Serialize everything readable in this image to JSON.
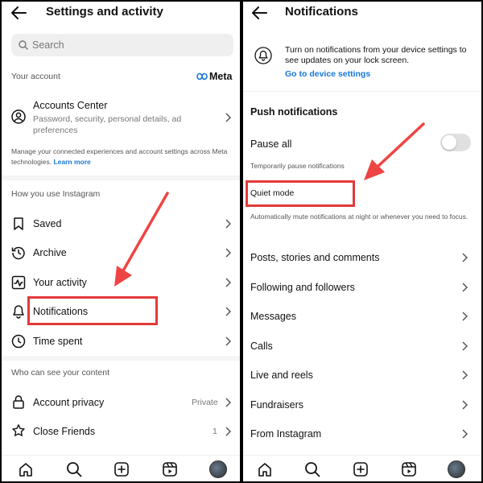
{
  "left": {
    "header": {
      "title": "Settings and activity"
    },
    "search": {
      "placeholder": "Search"
    },
    "your_account": {
      "section_label": "Your account",
      "meta_logo_text": "Meta",
      "accounts_center": {
        "title": "Accounts Center",
        "subtitle": "Password, security, personal details, ad preferences"
      },
      "manage_text": "Manage your connected experiences and account settings across Meta technologies.",
      "learn_more": "Learn more"
    },
    "how_you_use": {
      "section_label": "How you use Instagram",
      "items": [
        {
          "label": "Saved",
          "icon": "bookmark-icon"
        },
        {
          "label": "Archive",
          "icon": "archive-icon"
        },
        {
          "label": "Your activity",
          "icon": "activity-icon"
        },
        {
          "label": "Notifications",
          "icon": "bell-icon"
        },
        {
          "label": "Time spent",
          "icon": "clock-icon"
        }
      ]
    },
    "who_can_see": {
      "section_label": "Who can see your content",
      "items": [
        {
          "label": "Account privacy",
          "value": "Private",
          "icon": "lock-icon"
        },
        {
          "label": "Close Friends",
          "value": "1",
          "icon": "star-icon"
        }
      ]
    }
  },
  "right": {
    "header": {
      "title": "Notifications"
    },
    "banner": {
      "text": "Turn on notifications from your device settings to see updates on your lock screen.",
      "link": "Go to device settings"
    },
    "push": {
      "section_label": "Push notifications",
      "pause_all": {
        "label": "Pause all",
        "toggle_on": false,
        "hint": "Temporarily pause notifications"
      },
      "quiet_mode": {
        "label": "Quiet mode",
        "hint": "Automatically mute notifications at night or whenever you need to focus."
      }
    },
    "items": [
      {
        "label": "Posts, stories and comments"
      },
      {
        "label": "Following and followers"
      },
      {
        "label": "Messages"
      },
      {
        "label": "Calls"
      },
      {
        "label": "Live and reels"
      },
      {
        "label": "Fundraisers"
      },
      {
        "label": "From Instagram"
      }
    ]
  },
  "bottom_nav": [
    "home-icon",
    "search-icon",
    "create-icon",
    "reels-icon",
    "profile-avatar"
  ],
  "colors": {
    "highlight": "#e23a3a",
    "link": "#1877d5",
    "arrow": "#ef4444"
  }
}
